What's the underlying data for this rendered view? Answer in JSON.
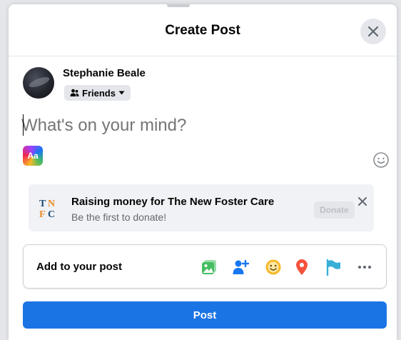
{
  "dialog": {
    "title": "Create Post",
    "close_icon": "close-icon"
  },
  "user": {
    "name": "Stephanie Beale",
    "audience_label": "Friends",
    "audience_icon": "friends-icon"
  },
  "composer": {
    "placeholder": "What's on your mind?",
    "text_format_label": "Aa",
    "emoji_icon": "smiley-icon"
  },
  "fundraiser": {
    "logo_text": "TNFC",
    "title": "Raising money for The New Foster Care",
    "subtitle": "Be the first to donate!",
    "donate_label": "Donate",
    "close_icon": "close-icon"
  },
  "add_to_post": {
    "label": "Add to your post",
    "items": [
      {
        "name": "photo-video-icon",
        "color": "#45bd62"
      },
      {
        "name": "tag-people-icon",
        "color": "#1877f2"
      },
      {
        "name": "feeling-activity-icon",
        "color": "#f7b928"
      },
      {
        "name": "check-in-icon",
        "color": "#f5533d"
      },
      {
        "name": "life-event-flag-icon",
        "color": "#39afd5"
      },
      {
        "name": "more-icon",
        "color": "#606770"
      }
    ]
  },
  "post_button": {
    "label": "Post",
    "color": "#1b74e4"
  }
}
